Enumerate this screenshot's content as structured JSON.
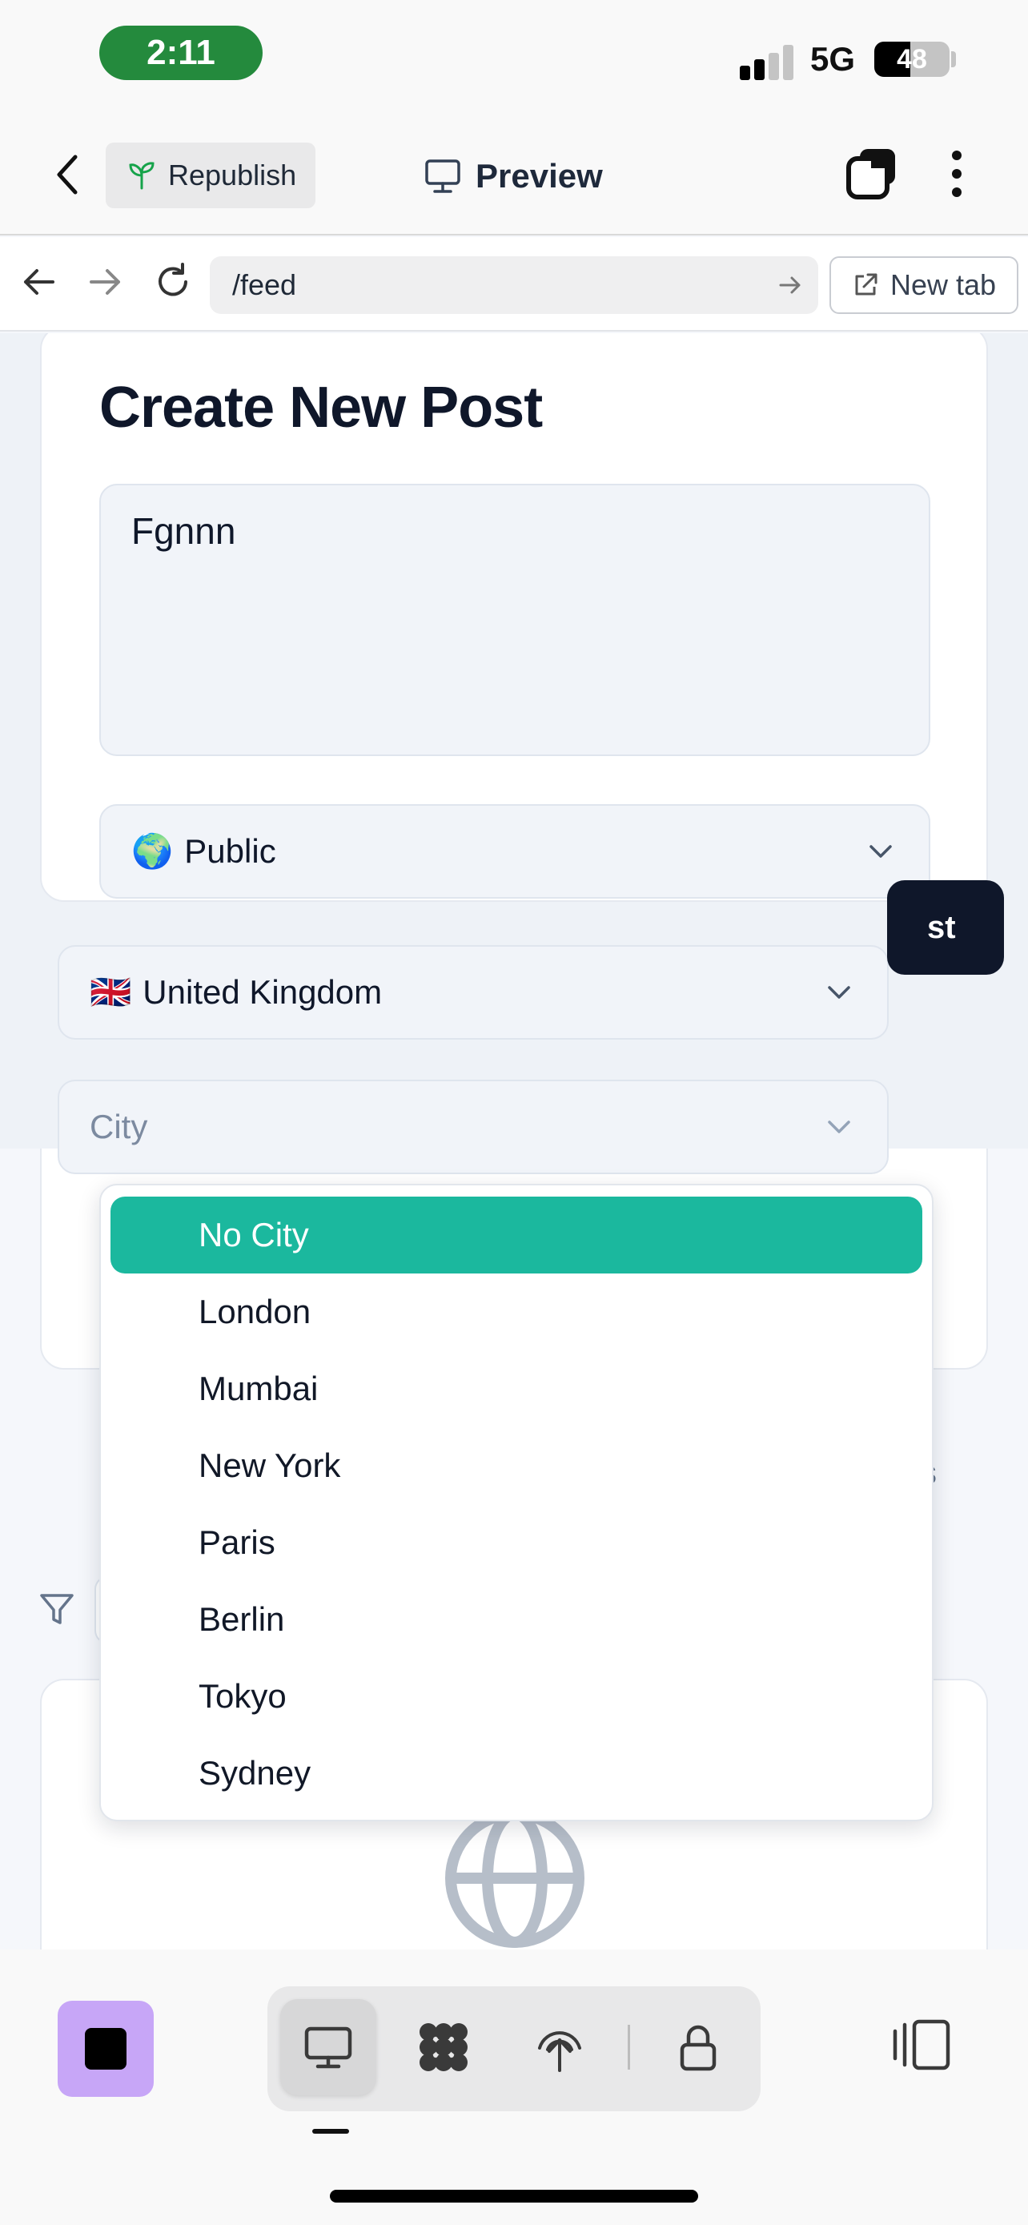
{
  "status_bar": {
    "time": "2:11",
    "network": "5G",
    "battery": "48",
    "battery_level": 0.48
  },
  "header": {
    "republish_label": "Republish",
    "preview_label": "Preview",
    "icons": [
      "back-chevron-icon",
      "sprout-icon",
      "monitor-icon",
      "tabs-icon",
      "more-vertical-icon"
    ]
  },
  "browser": {
    "url": "/feed",
    "new_tab_label": "New tab",
    "icons": [
      "arrow-left-icon",
      "arrow-right-icon",
      "reload-icon",
      "go-arrow-icon",
      "external-link-icon"
    ]
  },
  "form": {
    "title": "Create New Post",
    "post_text": "Fgnnn",
    "visibility": {
      "emoji": "🌍",
      "value": "Public"
    },
    "country": {
      "emoji": "🇬🇧",
      "value": "United Kingdom"
    },
    "city": {
      "placeholder": "City"
    },
    "submit_partial": "st"
  },
  "below": {
    "partial_text": "s"
  },
  "city_dropdown": {
    "selected": "No City",
    "options": [
      "No City",
      "London",
      "Mumbai",
      "New York",
      "Paris",
      "Berlin",
      "Tokyo",
      "Sydney"
    ]
  },
  "colors": {
    "selected_option": "#1bb89e",
    "submit_button": "#0f172a",
    "stop_button": "#c7a6f7",
    "time_pill": "#248a3d"
  },
  "toolbar": {
    "icons": [
      "stop-icon",
      "monitor-icon",
      "grid-blob-icon",
      "antenna-icon",
      "lock-icon",
      "panel-icon"
    ]
  }
}
